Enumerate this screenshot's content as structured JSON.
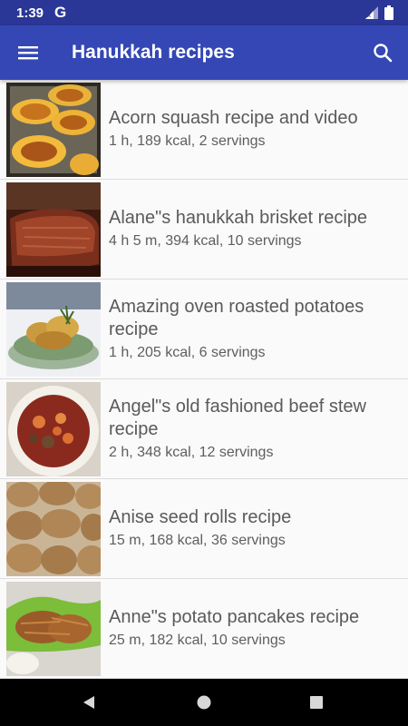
{
  "status_bar": {
    "time": "1:39",
    "g_label": "G",
    "icons": [
      "signal-icon",
      "battery-icon"
    ]
  },
  "app_bar": {
    "title": "Hanukkah recipes",
    "background": "#3447b4",
    "status_background": "#2a3796",
    "menu_icon": "hamburger-menu-icon",
    "search_icon": "search-icon"
  },
  "recipes": [
    {
      "title": "Acorn squash recipe and video",
      "meta": "1 h, 189 kcal, 2 servings"
    },
    {
      "title": "Alane\"s hanukkah brisket recipe",
      "meta": "4 h 5 m, 394 kcal, 10 servings"
    },
    {
      "title": "Amazing oven roasted potatoes recipe",
      "meta": "1 h, 205 kcal, 6 servings"
    },
    {
      "title": "Angel\"s old fashioned beef stew recipe",
      "meta": "2 h, 348 kcal, 12 servings"
    },
    {
      "title": "Anise seed rolls recipe",
      "meta": "15 m, 168 kcal, 36 servings"
    },
    {
      "title": "Anne\"s potato pancakes recipe",
      "meta": "25 m, 182 kcal, 10 servings"
    }
  ],
  "nav_bar": {
    "icons": [
      "back-icon",
      "home-icon",
      "recents-icon"
    ]
  }
}
